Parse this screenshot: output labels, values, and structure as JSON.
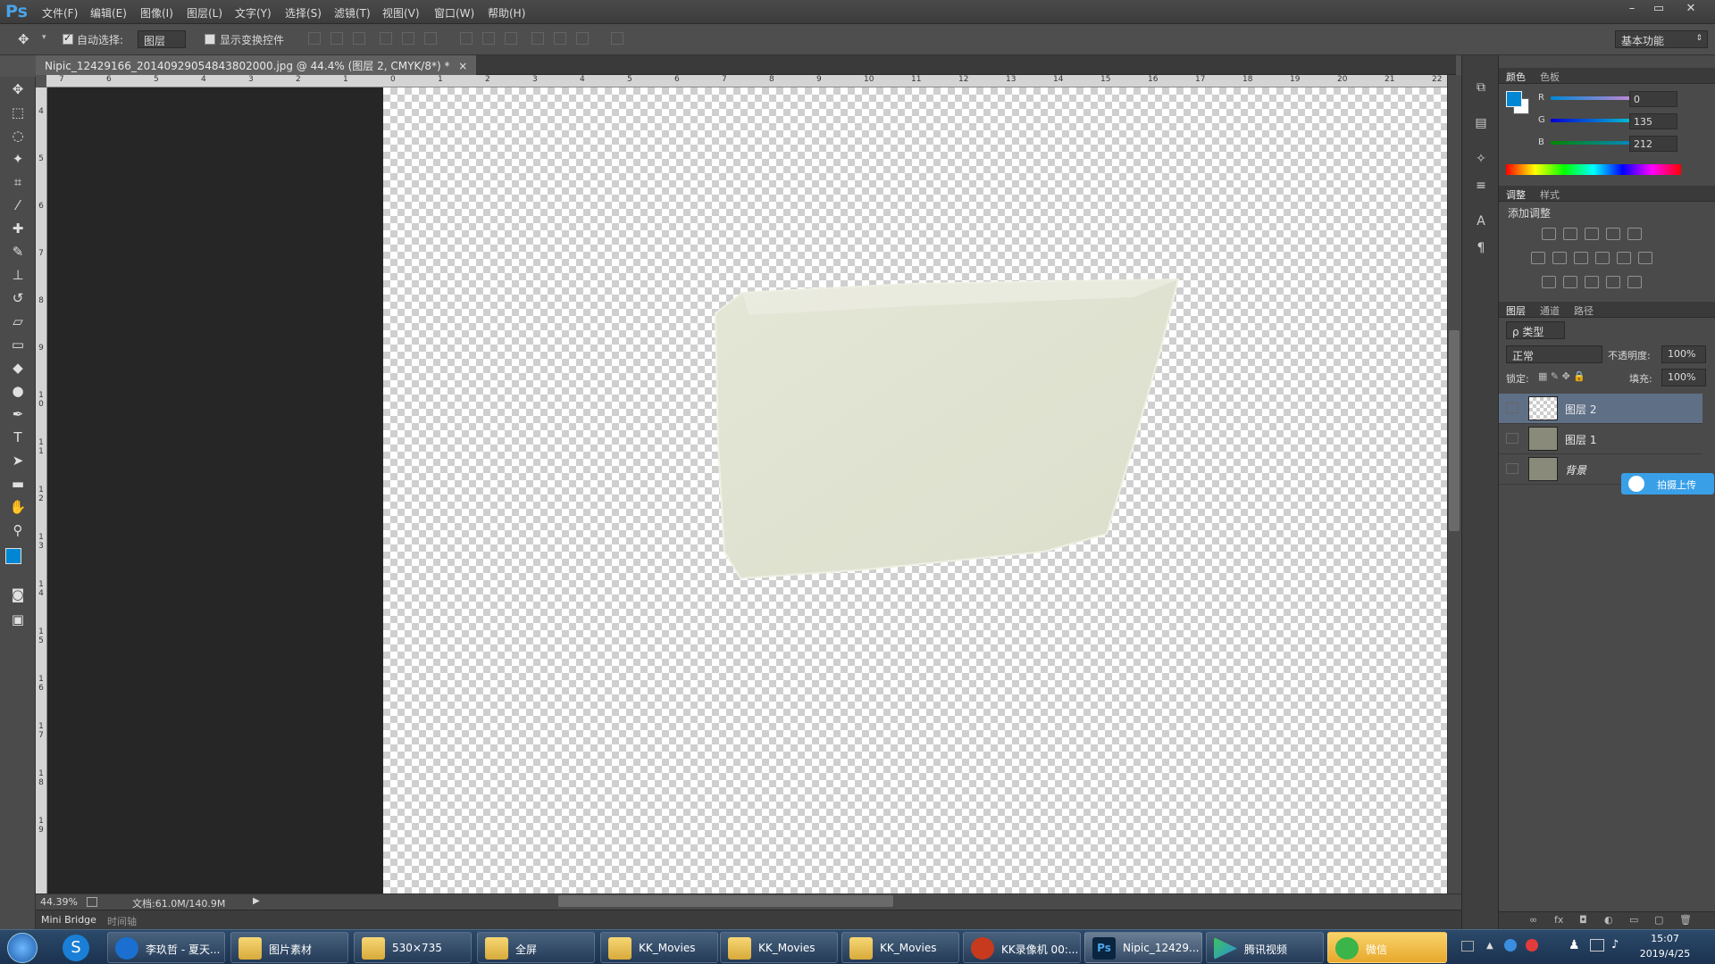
{
  "app": {
    "logo": "Ps",
    "window_buttons": [
      "–",
      "▭",
      "✕"
    ]
  },
  "menu": [
    "文件(F)",
    "编辑(E)",
    "图像(I)",
    "图层(L)",
    "文字(Y)",
    "选择(S)",
    "滤镜(T)",
    "视图(V)",
    "窗口(W)",
    "帮助(H)"
  ],
  "options": {
    "auto_select_label": "自动选择:",
    "auto_select_value": "图层",
    "show_transform_label": "显示变换控件",
    "workspace": "基本功能"
  },
  "document": {
    "tab_title": "Nipic_12429166_20140929054843802000.jpg @ 44.4% (图层 2, CMYK/8*) *",
    "close": "×",
    "zoom": "44.39%",
    "doc_size": "文档:61.0M/140.9M"
  },
  "ruler": {
    "h": [
      "7",
      "6",
      "5",
      "4",
      "3",
      "2",
      "1",
      "0",
      "1",
      "2",
      "3",
      "4",
      "5",
      "6",
      "7",
      "8",
      "9",
      "10",
      "11",
      "12",
      "13",
      "14",
      "15",
      "16",
      "17",
      "18",
      "19",
      "20",
      "21",
      "22"
    ],
    "v": [
      "4",
      "5",
      "6",
      "7",
      "8",
      "9",
      "1 0",
      "1 1",
      "1 2",
      "1 3",
      "1 4",
      "1 5",
      "1 6",
      "1 7",
      "1 8",
      "1 9"
    ]
  },
  "bottom_tabs": [
    "Mini Bridge",
    "时间轴"
  ],
  "color_panel": {
    "tabs": [
      "颜色",
      "色板"
    ],
    "r_label": "R",
    "g_label": "G",
    "b_label": "B",
    "r": "0",
    "g": "135",
    "b": "212",
    "fg_color": "#0087d4",
    "bg_color": "#ffffff"
  },
  "adjust_panel": {
    "tabs": [
      "调整",
      "样式"
    ],
    "heading": "添加调整"
  },
  "layers_panel": {
    "tabs": [
      "图层",
      "通道",
      "路径"
    ],
    "filter": "ρ 类型",
    "blend": "正常",
    "opacity_label": "不透明度:",
    "opacity": "100%",
    "lock_label": "锁定:",
    "fill_label": "填充:",
    "fill": "100%",
    "layers": [
      {
        "name": "图层 2",
        "selected": true
      },
      {
        "name": "图层 1",
        "selected": false
      },
      {
        "name": "背景",
        "selected": false
      }
    ],
    "upload_badge": "拍摄上传"
  },
  "taskbar": {
    "items": [
      "李玖哲 - 夏天...",
      "图片素材",
      "530×735",
      "全屏",
      "KK_Movies",
      "KK_Movies",
      "KK_Movies",
      "KK录像机 00:...",
      "Nipic_12429...",
      "腾讯视频",
      "微信"
    ],
    "time": "15:07",
    "date": "2019/4/25"
  }
}
